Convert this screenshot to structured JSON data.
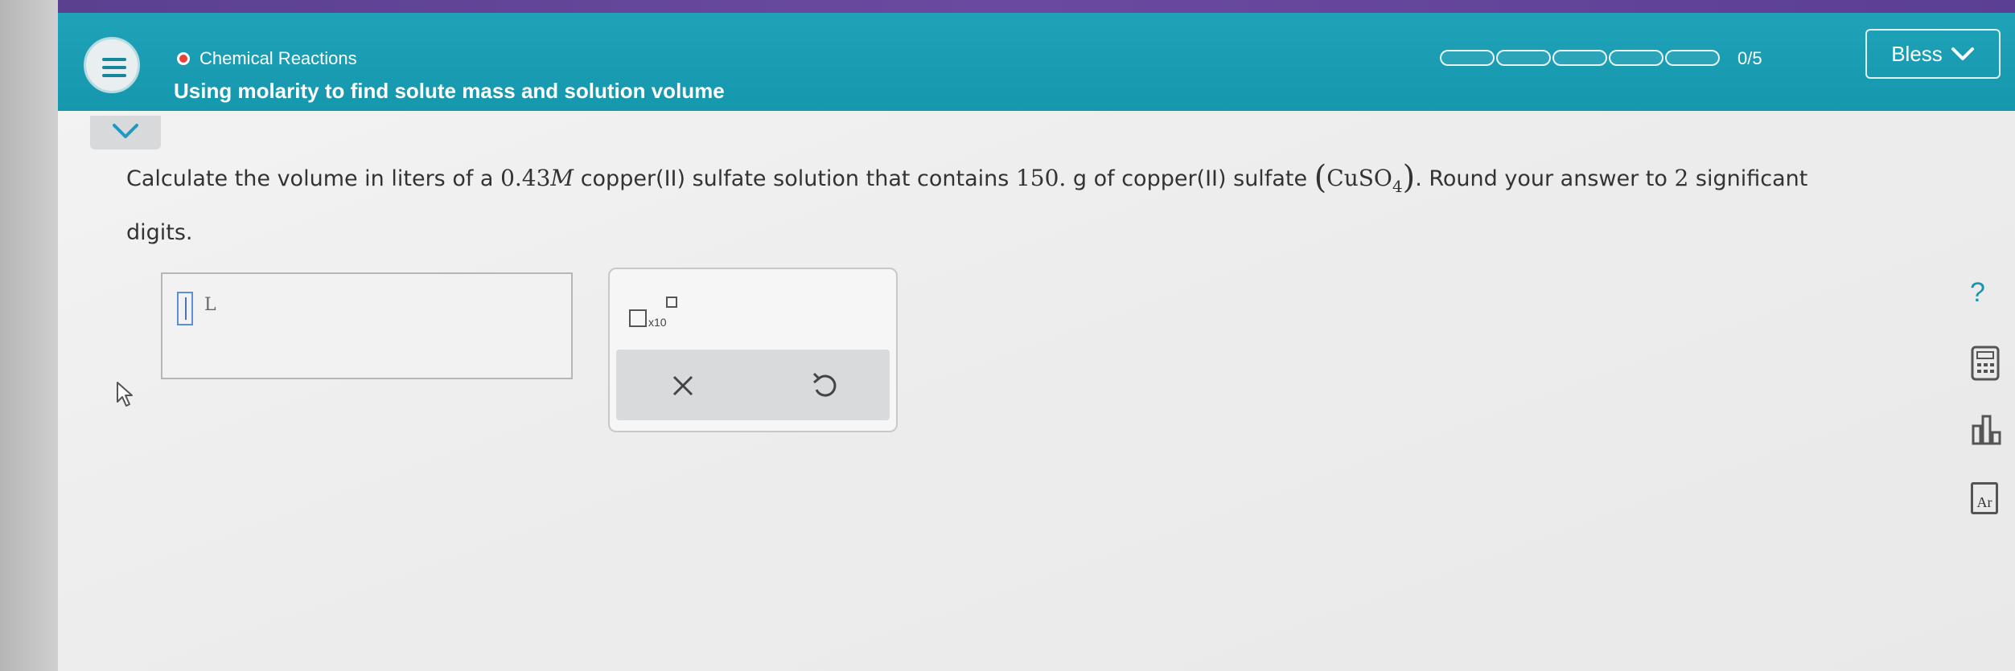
{
  "header": {
    "topic": "Chemical Reactions",
    "title": "Using molarity to find solute mass and solution volume",
    "progress": {
      "text": "0/5",
      "completed": 0,
      "total": 5
    },
    "user": "Bless"
  },
  "question": {
    "part1": "Calculate the volume in liters of a",
    "molarity_value": "0.43",
    "molarity_unit": "M",
    "part2": "copper(II) sulfate solution that contains",
    "mass_value": "150.",
    "part3": "g of copper(II) sulfate",
    "formula_main": "CuSO",
    "formula_sub": "4",
    "part4": ". Round your answer to",
    "sig_figs": "2",
    "part5": "significant",
    "line2": "digits."
  },
  "answer": {
    "value": "",
    "unit": "L"
  },
  "tools": {
    "x10_label": "x10"
  },
  "side_tools": {
    "help_label": "?",
    "periodic_label": "Ar"
  },
  "colors": {
    "teal": "#1597ad",
    "topic_dot": "#e8423c"
  },
  "icons": [
    "menu-icon",
    "chevron-down-icon",
    "x10-icon",
    "clear-icon",
    "undo-icon",
    "help-icon",
    "calculator-icon",
    "chart-icon",
    "periodic-table-icon",
    "mouse-pointer-icon"
  ]
}
